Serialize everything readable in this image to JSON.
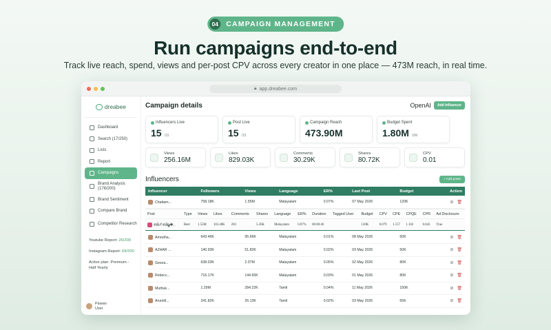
{
  "badge": {
    "number": "04",
    "label": "CAMPAIGN MANAGEMENT"
  },
  "headline": "Run campaigns end-to-end",
  "subheadline": "Track live reach, spend, views and per-post CPV across every creator in one place — 473M reach, in real time.",
  "browser": {
    "url": "app.dreabee.com"
  },
  "app": {
    "logo_text": "dreabee"
  },
  "sidebar": {
    "items": [
      {
        "label": "Dashboard",
        "icon": "dashboard-icon"
      },
      {
        "label": "Search (17/250)",
        "icon": "search-icon"
      },
      {
        "label": "Lists",
        "icon": "list-icon"
      },
      {
        "label": "Report",
        "icon": "report-icon"
      },
      {
        "label": "Campaigns",
        "icon": "campaign-icon",
        "active": true
      },
      {
        "label": "Brand Analysis (178/200)",
        "icon": "chart-icon"
      },
      {
        "label": "Brand Sentiment",
        "icon": "sentiment-icon"
      },
      {
        "label": "Compare Brand",
        "icon": "compare-icon"
      },
      {
        "label": "Competitor Research",
        "icon": "research-icon"
      }
    ],
    "youtube_report": {
      "label": "Youtube Report:",
      "value": "26/200"
    },
    "instagram_report": {
      "label": "Instagram Report:",
      "value": "69/200"
    },
    "plan": "Active plan: Premium - Half Yearly",
    "user": {
      "name": "Pawan",
      "role": "User"
    }
  },
  "main": {
    "title": "Campaign details",
    "client": "OpenAI",
    "add_button": "Add Influencer",
    "stats": [
      {
        "label": "Influencers Live",
        "value": "15",
        "suffix": "/15"
      },
      {
        "label": "Post Live",
        "value": "15",
        "suffix": "/15"
      },
      {
        "label": "Campaign Reach",
        "value": "473.90M",
        "suffix": ""
      },
      {
        "label": "Budget Spent",
        "value": "1.80M",
        "suffix": "/2M"
      }
    ],
    "metrics": [
      {
        "label": "Views",
        "value": "256.16M"
      },
      {
        "label": "Likes",
        "value": "829.03K"
      },
      {
        "label": "Comments",
        "value": "30.29K"
      },
      {
        "label": "Shares",
        "value": "80.72K"
      },
      {
        "label": "CPV",
        "value": "0.01"
      }
    ],
    "influencers_title": "Influencers",
    "add_posts_button": "+ Add posts",
    "table": {
      "headers": [
        "Influencer",
        "Followers",
        "Views",
        "Language",
        "ER%",
        "Last Post",
        "Budget",
        "Action"
      ],
      "rows": [
        [
          "Chattam...",
          "758.18K",
          "1.55M",
          "Malayalam",
          "0.07%",
          "07 May 2026",
          "120K"
        ],
        [
          "Amrutha...",
          "643.46K",
          "95.66K",
          "Malayalam",
          "0.01%",
          "08 May 2026",
          "60K"
        ],
        [
          "AZHAR ...",
          "140.93K",
          "51.82K",
          "Malayalam",
          "0.02%",
          "03 May 2026",
          "50K"
        ],
        [
          "Geeza...",
          "638.03K",
          "2.07M",
          "Malayalam",
          "0.05%",
          "02 May 2026",
          "80K"
        ],
        [
          "Rebecc...",
          "716.17K",
          "144.65K",
          "Malayalam",
          "0.03%",
          "01 May 2026",
          "80K"
        ],
        [
          "Muthuk...",
          "1.29M",
          "284.22K",
          "Tamil",
          "0.04%",
          "11 May 2026",
          "150K"
        ],
        [
          "Arumitl...",
          "241.82K",
          "26.13K",
          "Tamil",
          "0.02%",
          "03 May 2026",
          "65K"
        ]
      ]
    },
    "post_table": {
      "headers": [
        "Post",
        "Type",
        "Views",
        "Likes",
        "Comments",
        "Shares",
        "Language",
        "ER%",
        "Duration",
        "Tagged User",
        "Budget",
        "CPV",
        "CPE",
        "CPQE",
        "CPR",
        "Ad Disclosure"
      ],
      "row": [
        "ബിഗ് ബില്ല�...",
        "Reel",
        "1.55M",
        "103.48K",
        "203",
        "5.26K",
        "Malayalam",
        "0.07%",
        "00:00:40",
        "",
        "120K",
        "0.079",
        "1.157",
        "1.102",
        "0.043",
        "True"
      ]
    }
  }
}
